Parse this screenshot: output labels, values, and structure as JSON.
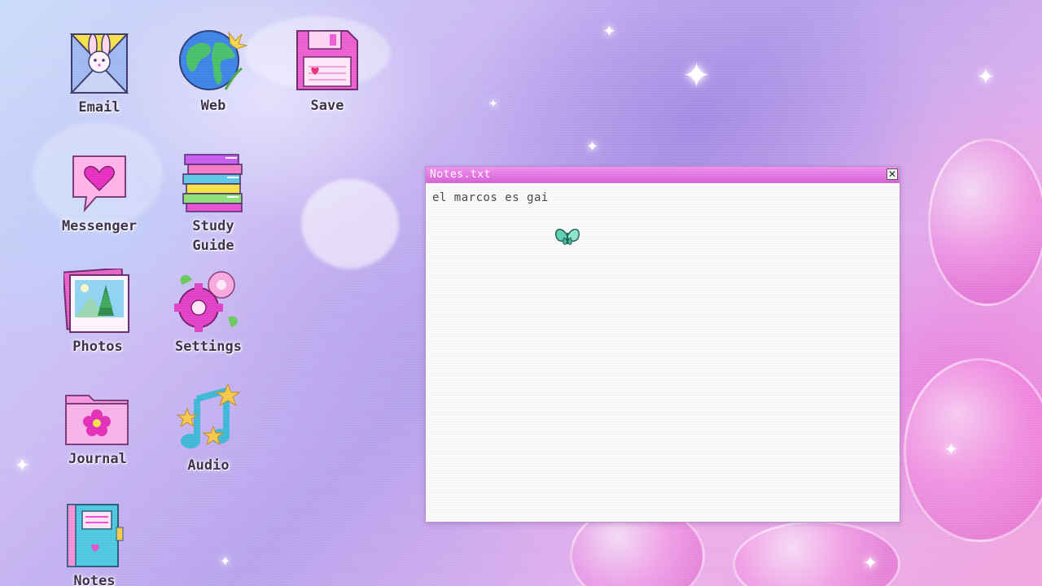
{
  "desktop": {
    "icons": [
      {
        "label": "Email",
        "icon": "envelope-bunny-icon"
      },
      {
        "label": "Web",
        "icon": "globe-icon"
      },
      {
        "label": "Save",
        "icon": "floppy-disk-icon"
      },
      {
        "label": "Messenger",
        "icon": "heart-speech-bubble-icon"
      },
      {
        "label": "Study\nGuide",
        "icon": "book-stack-icon"
      },
      {
        "label": "Photos",
        "icon": "photo-frame-icon"
      },
      {
        "label": "Settings",
        "icon": "gear-flower-icon"
      },
      {
        "label": "Journal",
        "icon": "flower-folder-icon"
      },
      {
        "label": "Audio",
        "icon": "music-note-icon"
      },
      {
        "label": "Notes",
        "icon": "notebook-icon"
      }
    ]
  },
  "notes_window": {
    "title": "Notes.txt",
    "content": "el marcos es gai",
    "close_glyph": "✕"
  },
  "colors": {
    "title_bar": "#d65fd4",
    "accent_pink": "#e84fd0",
    "label_text": "#3a2f4a"
  },
  "cursor": {
    "icon": "pixel-butterfly-cursor-icon"
  }
}
